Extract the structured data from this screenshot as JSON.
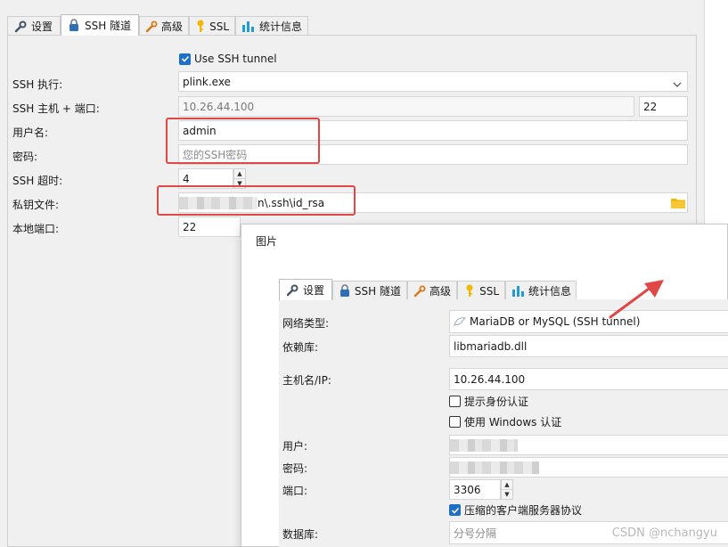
{
  "main": {
    "tabs": [
      {
        "label": "设置",
        "icon": "wrench-icon"
      },
      {
        "label": "SSH 隧道",
        "icon": "lock-icon"
      },
      {
        "label": "高级",
        "icon": "tools-icon"
      },
      {
        "label": "SSL",
        "icon": "key-icon"
      },
      {
        "label": "统计信息",
        "icon": "bar-chart-icon"
      }
    ],
    "use_ssh_tunnel_label": "Use SSH tunnel",
    "ssh_exec_label": "SSH 执行:",
    "ssh_exec_value": "plink.exe",
    "ssh_host_label": "SSH 主机 + 端口:",
    "ssh_host_value": "10.26.44.100",
    "ssh_port_value": "22",
    "username_label": "用户名:",
    "username_value": "admin",
    "password_label": "密码:",
    "password_placeholder": "您的SSH密码",
    "timeout_label": "SSH 超时:",
    "timeout_value": "4",
    "keyfile_label": "私钥文件:",
    "keyfile_value": "n\\.ssh\\id_rsa",
    "local_port_label": "本地端口:",
    "local_port_value": "22"
  },
  "dialog": {
    "title": "图片",
    "tabs": [
      {
        "label": "设置",
        "icon": "wrench-icon"
      },
      {
        "label": "SSH 隧道",
        "icon": "lock-icon"
      },
      {
        "label": "高级",
        "icon": "tools-icon"
      },
      {
        "label": "SSL",
        "icon": "key-icon"
      },
      {
        "label": "统计信息",
        "icon": "bar-chart-icon"
      }
    ],
    "network_type_label": "网络类型:",
    "network_type_value": "MariaDB or MySQL (SSH tunnel)",
    "library_label": "依赖库:",
    "library_value": "libmariadb.dll",
    "hostname_label": "主机名/IP:",
    "hostname_value": "10.26.44.100",
    "prompt_auth_label": "提示身份认证",
    "windows_auth_label": "使用 Windows 认证",
    "user_label": "用户:",
    "password_label": "密码:",
    "port_label": "端口:",
    "port_value": "3306",
    "compress_label": "压缩的客户端服务器协议",
    "database_label": "数据库:",
    "database_placeholder": "分号分隔"
  },
  "watermark": "CSDN @nchangyu",
  "colors": {
    "accent": "#1e6fc8",
    "highlight": "#e04747",
    "folder": "#f2b705"
  }
}
